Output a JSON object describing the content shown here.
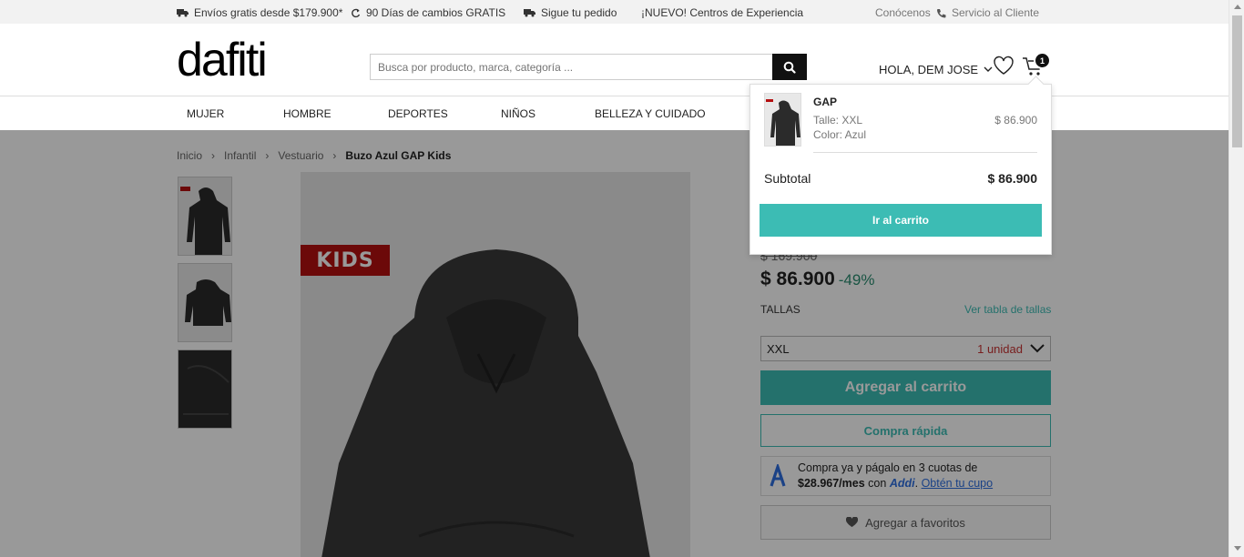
{
  "topbar": {
    "shipping": "Envíos gratis desde $179.900*",
    "returns": "90 Días de cambios GRATIS",
    "track": "Sigue tu pedido",
    "experience": "¡NUEVO! Centros de Experiencia",
    "about": "Conócenos",
    "service": "Servicio al Cliente"
  },
  "header": {
    "logo": "dafiti",
    "search_placeholder": "Busca por producto, marca, categoría ...",
    "greeting": "HOLA, DEM JOSE",
    "cart_count": "1"
  },
  "nav": {
    "items": [
      "MUJER",
      "HOMBRE",
      "DEPORTES",
      "NIÑOS",
      "BELLEZA Y CUIDADO"
    ]
  },
  "breadcrumb": {
    "items": [
      "Inicio",
      "Infantil",
      "Vestuario"
    ],
    "current": "Buzo Azul GAP Kids"
  },
  "product": {
    "badge": "KIDS",
    "old_price": "$ 169.900",
    "price": "$ 86.900",
    "discount": "-49%",
    "sizes_label": "TALLAS",
    "size_chart": "Ver tabla de tallas",
    "selected_size": "XXL",
    "stock": "1 unidad",
    "add_to_cart": "Agregar al carrito",
    "quick_buy": "Compra rápida",
    "addi_line1": "Compra ya y págalo en 3 cuotas de",
    "addi_amount": "$28.967/mes",
    "addi_con": "con",
    "addi_brand": "Addi",
    "addi_link": "Obtén tu cupo",
    "favorites": "Agregar a favoritos"
  },
  "mini_cart": {
    "brand": "GAP",
    "size": "Talle: XXL",
    "color": "Color: Azul",
    "item_price": "$ 86.900",
    "subtotal_label": "Subtotal",
    "subtotal": "$ 86.900",
    "button": "Ir al carrito"
  },
  "colors": {
    "accent": "#3cbcb4",
    "stock_red": "#c83232",
    "kids_red": "#b40f10"
  }
}
